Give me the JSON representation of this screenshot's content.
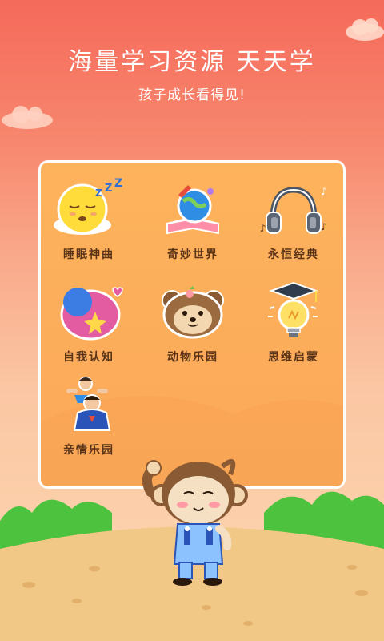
{
  "hero": {
    "title": "海量学习资源  天天学",
    "subtitle": "孩子成长看得见!"
  },
  "categories": [
    {
      "label": "睡眠神曲",
      "icon": "sleeping-moon-icon"
    },
    {
      "label": "奇妙世界",
      "icon": "globe-rocket-book-icon"
    },
    {
      "label": "永恒经典",
      "icon": "headphones-icon"
    },
    {
      "label": "自我认知",
      "icon": "colorful-blob-icon"
    },
    {
      "label": "动物乐园",
      "icon": "bear-face-icon"
    },
    {
      "label": "思维启蒙",
      "icon": "lightbulb-graduation-icon"
    },
    {
      "label": "亲情乐园",
      "icon": "family-icon"
    }
  ],
  "colors": {
    "background_top": "#f56a5a",
    "panel": "#fdb35b",
    "label_text": "#5a3418",
    "grass": "#4cc23e",
    "ground": "#f2c886"
  },
  "mascot": {
    "icon": "monkey-mascot-icon"
  }
}
